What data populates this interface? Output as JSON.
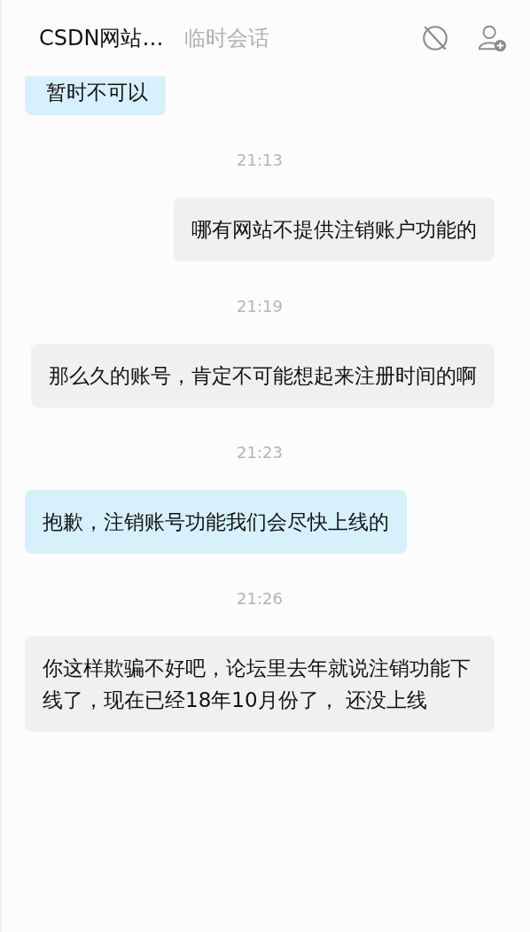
{
  "header": {
    "title": "CSDN网站…",
    "subtitle": "临时会话"
  },
  "messages": [
    {
      "kind": "received",
      "text": "暂时不可以"
    },
    {
      "kind": "time",
      "text": "21:13"
    },
    {
      "kind": "sent",
      "text": "哪有网站不提供注销账户功能的"
    },
    {
      "kind": "time",
      "text": "21:19"
    },
    {
      "kind": "sent",
      "text": "那么久的账号，肯定不可能想起来注册时间的啊"
    },
    {
      "kind": "time",
      "text": "21:23"
    },
    {
      "kind": "received",
      "text": "抱歉，注销账号功能我们会尽快上线的"
    },
    {
      "kind": "time",
      "text": "21:26"
    },
    {
      "kind": "sent",
      "text": "你这样欺骗不好吧，论坛里去年就说注销功能下线了，现在已经18年10月份了， 还没上线"
    }
  ]
}
